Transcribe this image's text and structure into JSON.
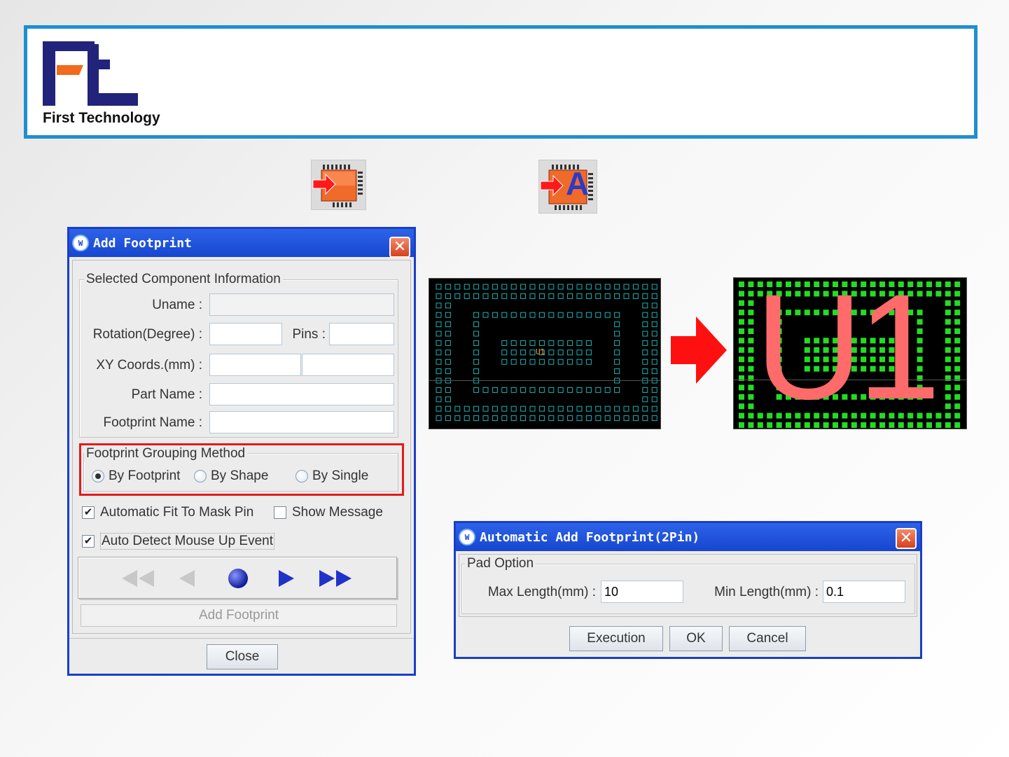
{
  "brand": {
    "company_name": "First Technology",
    "logo_letters": "Ft",
    "colors": {
      "navy": "#22237a",
      "orange": "#f26a1b",
      "frame": "#1f8fd0"
    }
  },
  "toolbar_icons": [
    {
      "name": "add-footprint-tool-icon",
      "letter": ""
    },
    {
      "name": "auto-add-footprint-tool-icon",
      "letter": "A"
    }
  ],
  "add_footprint_dialog": {
    "title": "Add Footprint",
    "close_glyph": "✕",
    "selected_info": {
      "legend": "Selected Component Information",
      "uname_label": "Uname :",
      "uname_value": "",
      "rotation_label": "Rotation(Degree) :",
      "rotation_value": "",
      "pins_label": "Pins :",
      "pins_value": "",
      "xy_label": "XY Coords.(mm) :",
      "x_value": "",
      "y_value": "",
      "part_name_label": "Part Name :",
      "part_name_value": "",
      "footprint_name_label": "Footprint Name :",
      "footprint_name_value": ""
    },
    "grouping": {
      "legend": "Footprint Grouping Method",
      "options": [
        "By Footprint",
        "By Shape",
        "By Single"
      ],
      "selected": "By Footprint"
    },
    "auto_fit_label": "Automatic Fit To Mask Pin",
    "auto_fit_checked": true,
    "show_message_label": "Show Message",
    "show_message_checked": false,
    "auto_detect_label": "Auto Detect Mouse Up Event",
    "auto_detect_checked": true,
    "nav_icons": [
      "first-icon",
      "prev-icon",
      "record-icon",
      "next-icon",
      "last-icon"
    ],
    "add_footprint_label": "Add Footprint",
    "close_label": "Close"
  },
  "pcb_views": {
    "before_label": "U1",
    "after_label": "U1",
    "pad_color_before": "#18b4b4",
    "pad_color_after": "#22dd22",
    "label_color_after": "#ff6a6a"
  },
  "auto_add_dialog": {
    "title": "Automatic Add Footprint(2Pin)",
    "close_glyph": "✕",
    "pad_option_legend": "Pad Option",
    "max_length_label": "Max Length(mm) :",
    "max_length_value": "10",
    "min_length_label": "Min Length(mm) :",
    "min_length_value": "0.1",
    "execution_label": "Execution",
    "ok_label": "OK",
    "cancel_label": "Cancel"
  }
}
